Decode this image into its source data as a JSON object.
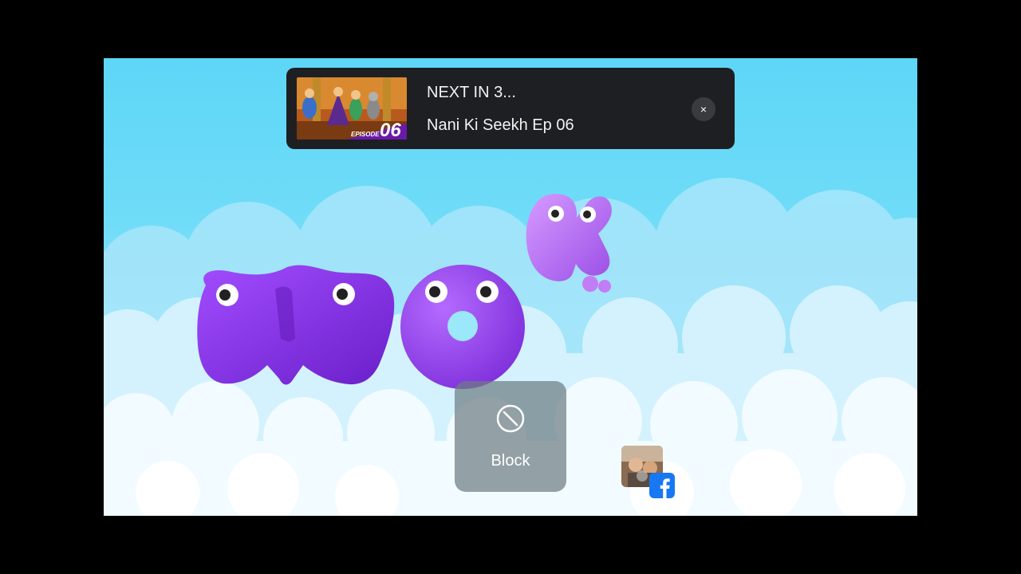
{
  "up_next": {
    "countdown": "NEXT IN 3...",
    "title": "Nani Ki Seekh Ep 06",
    "thumbnail": {
      "episode_label": "EPISODE",
      "episode_number": "06"
    },
    "close_icon": "close-icon",
    "close_glyph": "×"
  },
  "block_button": {
    "label": "Block",
    "icon": "block-icon"
  },
  "facebook_chat_head": {
    "icon": "facebook-icon"
  },
  "colors": {
    "sky": "#5ed6f7",
    "letter_purple": "#8a2be2",
    "panel_bg": "#1e1f22",
    "facebook_blue": "#1877f2"
  }
}
